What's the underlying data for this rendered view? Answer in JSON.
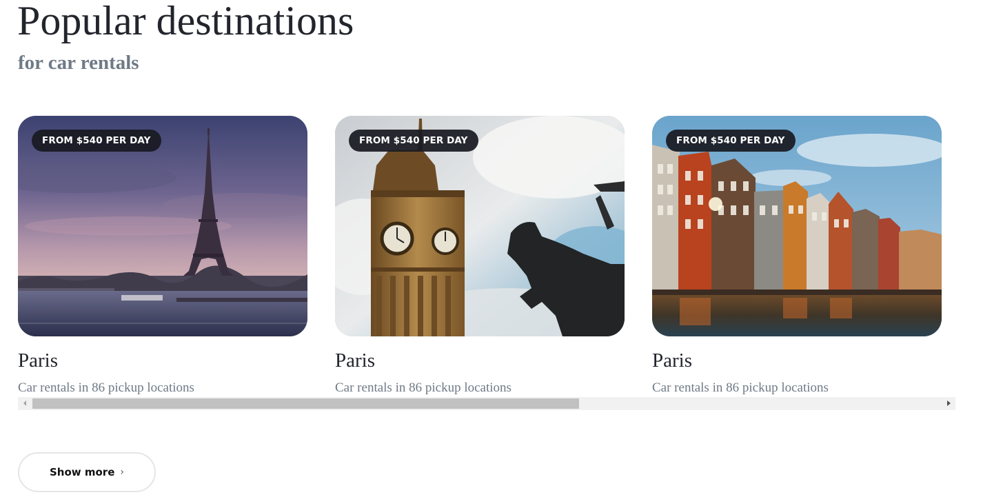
{
  "header": {
    "title": "Popular destinations",
    "subtitle": "for car rentals"
  },
  "cards": [
    {
      "badge": "FROM $540 PER DAY",
      "city": "Paris",
      "locations": "Car rentals in 86 pickup locations",
      "image_subject": "eiffel-tower-photo"
    },
    {
      "badge": "FROM $540 PER DAY",
      "city": "Paris",
      "locations": "Car rentals in 86 pickup locations",
      "image_subject": "big-ben-photo"
    },
    {
      "badge": "FROM $540 PER DAY",
      "city": "Paris",
      "locations": "Car rentals in 86 pickup locations",
      "image_subject": "canal-houses-photo"
    }
  ],
  "scrollbar": {
    "position_fraction": 0.0,
    "visible_fraction": 0.6
  },
  "show_more": {
    "label": "Show more",
    "icon": "chevron-right-icon"
  },
  "colors": {
    "badge_bg": "#181921",
    "heading": "#23252d",
    "muted_text": "#6f7a86",
    "button_border": "#e3e5e8"
  }
}
